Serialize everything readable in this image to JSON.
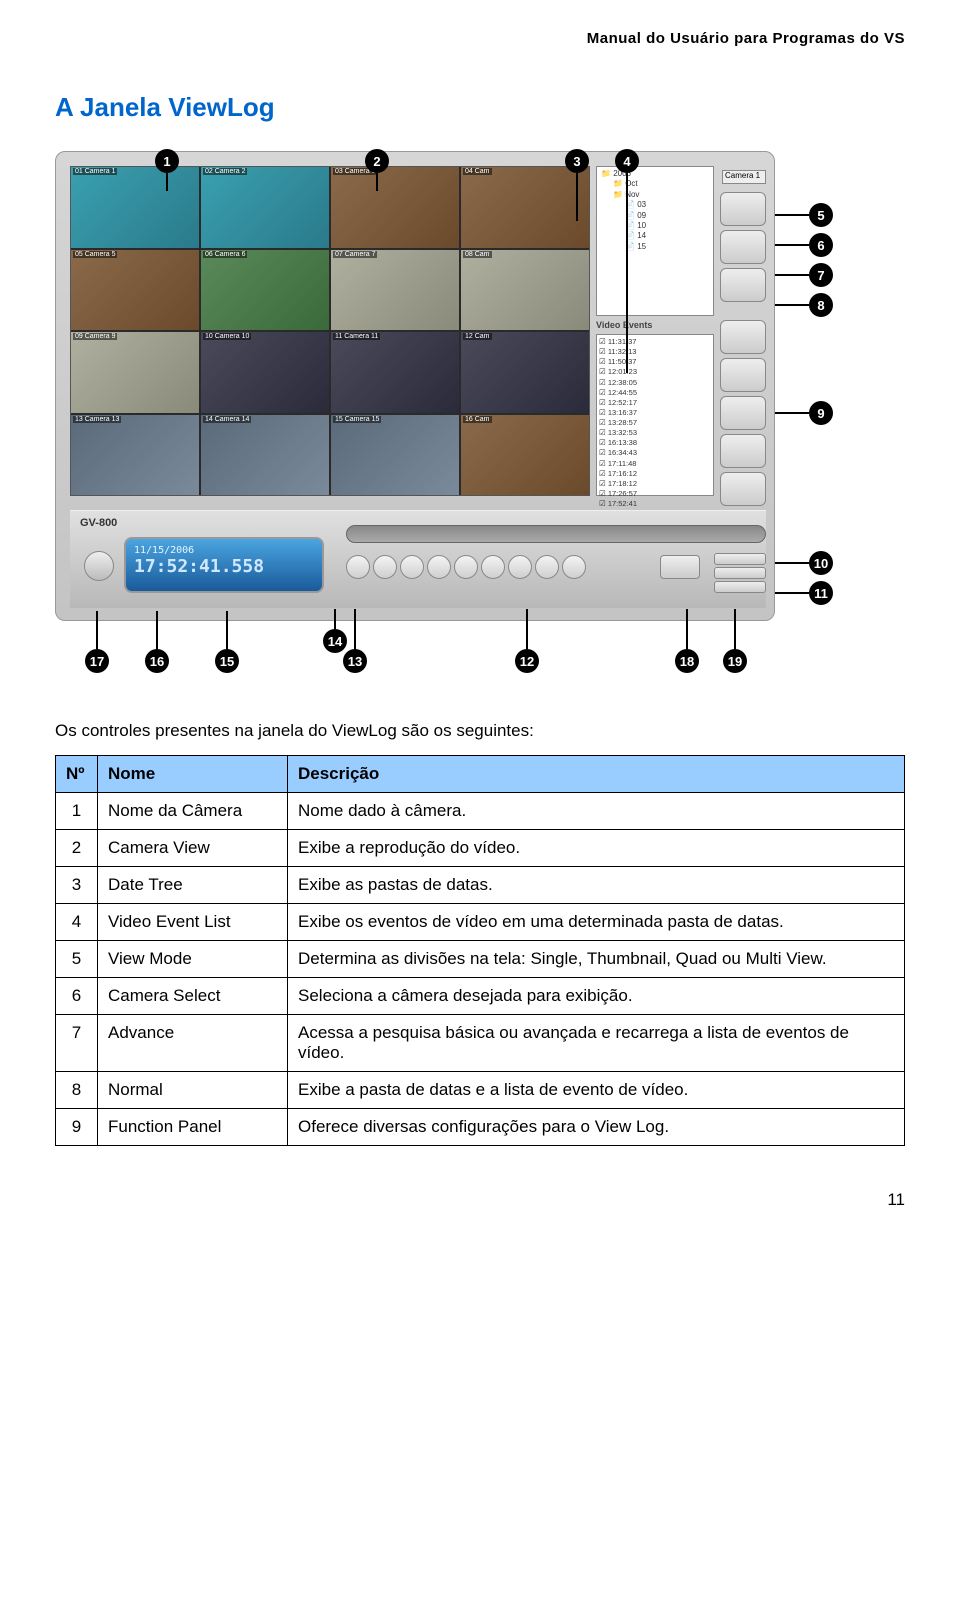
{
  "header": {
    "title": "Manual do Usuário para Programas do VS"
  },
  "section": {
    "title": "A Janela ViewLog"
  },
  "figure": {
    "logo": "GV-800",
    "lcd_date": "11/15/2006",
    "lcd_time": "17:52:41.558",
    "camera_select_label": "Camera 1",
    "events_label": "Video Events",
    "date_tree": {
      "root": "2006",
      "items": [
        "Oct",
        "Nov",
        "03",
        "09",
        "10",
        "14",
        "15"
      ]
    },
    "events": [
      "11:31:37",
      "11:32:13",
      "11:50:37",
      "12:01:23",
      "12:38:05",
      "12:44:55",
      "12:52:17",
      "13:16:37",
      "13:28:57",
      "13:32:53",
      "16:13:38",
      "16:34:43",
      "17:11:48",
      "17:16:12",
      "17:18:12",
      "17:26:57",
      "17:52:41"
    ],
    "cameras": [
      "01 Camera 1",
      "02 Camera 2",
      "03 Camera 3",
      "04 Cam",
      "05 Camera 5",
      "06 Camera 6",
      "07 Camera 7",
      "08 Cam",
      "09 Camera 9",
      "10 Camera 10",
      "11 Camera 11",
      "12 Cam",
      "13 Camera 13",
      "14 Camera 14",
      "15 Camera 15",
      "16 Cam"
    ]
  },
  "callouts": {
    "n1": "1",
    "n2": "2",
    "n3": "3",
    "n4": "4",
    "n5": "5",
    "n6": "6",
    "n7": "7",
    "n8": "8",
    "n9": "9",
    "n10": "10",
    "n11": "11",
    "n12": "12",
    "n13": "13",
    "n14": "14",
    "n15": "15",
    "n16": "16",
    "n17": "17",
    "n18": "18",
    "n19": "19"
  },
  "intro": "Os controles presentes na janela do ViewLog são os seguintes:",
  "table": {
    "headers": {
      "num": "Nº",
      "name": "Nome",
      "desc": "Descrição"
    },
    "rows": [
      {
        "num": "1",
        "name": "Nome da Câmera",
        "desc": "Nome dado à câmera."
      },
      {
        "num": "2",
        "name": "Camera View",
        "desc": "Exibe a reprodução do vídeo."
      },
      {
        "num": "3",
        "name": "Date Tree",
        "desc": "Exibe as pastas de datas."
      },
      {
        "num": "4",
        "name": "Video Event List",
        "desc": "Exibe os eventos de vídeo em uma determinada pasta de datas."
      },
      {
        "num": "5",
        "name": "View Mode",
        "desc": "Determina as divisões na tela: Single, Thumbnail, Quad ou Multi View."
      },
      {
        "num": "6",
        "name": "Camera Select",
        "desc": "Seleciona a câmera desejada para exibição."
      },
      {
        "num": "7",
        "name": "Advance",
        "desc": "Acessa a pesquisa básica ou avançada e recarrega a lista de eventos de vídeo."
      },
      {
        "num": "8",
        "name": "Normal",
        "desc": "Exibe a pasta de datas e a lista de evento de vídeo."
      },
      {
        "num": "9",
        "name": "Function Panel",
        "desc": "Oferece diversas configurações para o View Log."
      }
    ]
  },
  "pagenum": "11"
}
